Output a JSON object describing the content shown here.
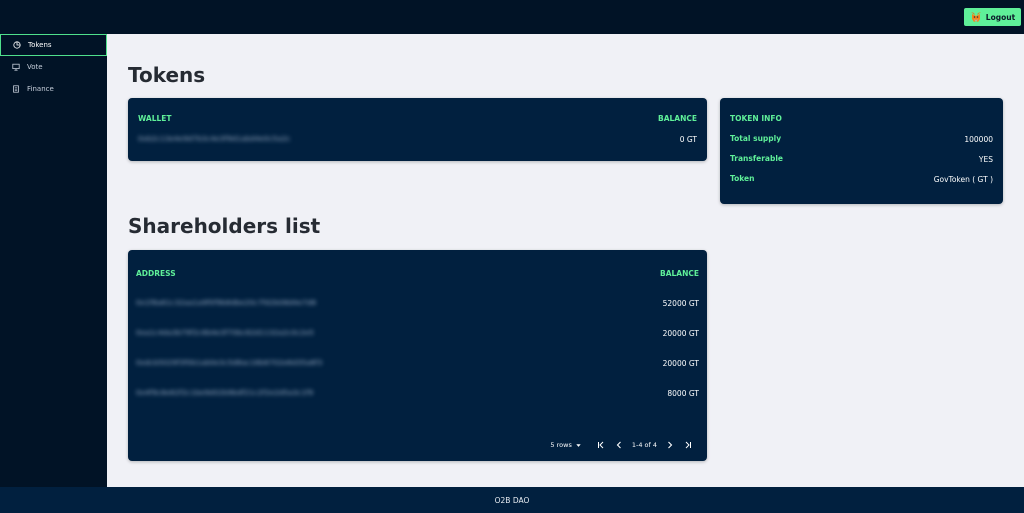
{
  "topbar": {
    "logout_label": "Logout"
  },
  "sidebar": {
    "items": [
      {
        "label": "Tokens",
        "icon": "pie-chart-icon",
        "active": true
      },
      {
        "label": "Vote",
        "icon": "monitor-icon",
        "active": false
      },
      {
        "label": "Finance",
        "icon": "document-icon",
        "active": false
      }
    ]
  },
  "tokens_section": {
    "title": "Tokens",
    "wallet_header": "WALLET",
    "balance_header": "BALANCE",
    "wallet_address": "0xb2c13e4e9d7b3c4e3f9d1abd4e0c5a2c",
    "wallet_balance": "0 GT"
  },
  "token_info": {
    "title": "TOKEN INFO",
    "rows": [
      {
        "label": "Total supply",
        "value": "100000"
      },
      {
        "label": "Transferable",
        "value": "YES"
      },
      {
        "label": "Token",
        "value": "GovToken ( GT )"
      }
    ]
  },
  "shareholders": {
    "title": "Shareholders list",
    "address_header": "ADDRESS",
    "balance_header": "BALANCE",
    "rows": [
      {
        "address": "0x1f8a61c32aa1a9f0f9b8dbe20c7fd2b08d4e7d8",
        "balance": "52000 GT"
      },
      {
        "address": "0xa1c4da3b79f2c6b4e3f70bc62d1132a2c0c2e5",
        "balance": "20000 GT"
      },
      {
        "address": "0xdcb5029f3f0b1ab0e3c5d8ac16b6702e6d35a8f3",
        "balance": "20000 GT"
      },
      {
        "address": "0x4f9c8e82f2c1be9d02b9bdf21c2f2e2d5a3c1f9",
        "balance": "8000 GT"
      }
    ],
    "pagination": {
      "rows_per_page": "5 rows",
      "range": "1-4 of 4"
    }
  },
  "footer": {
    "text": "O2B DAO"
  },
  "colors": {
    "accent": "#5ff099",
    "dark_bg": "#011326",
    "card_bg": "#01203f",
    "page_bg": "#f0f1f6"
  }
}
